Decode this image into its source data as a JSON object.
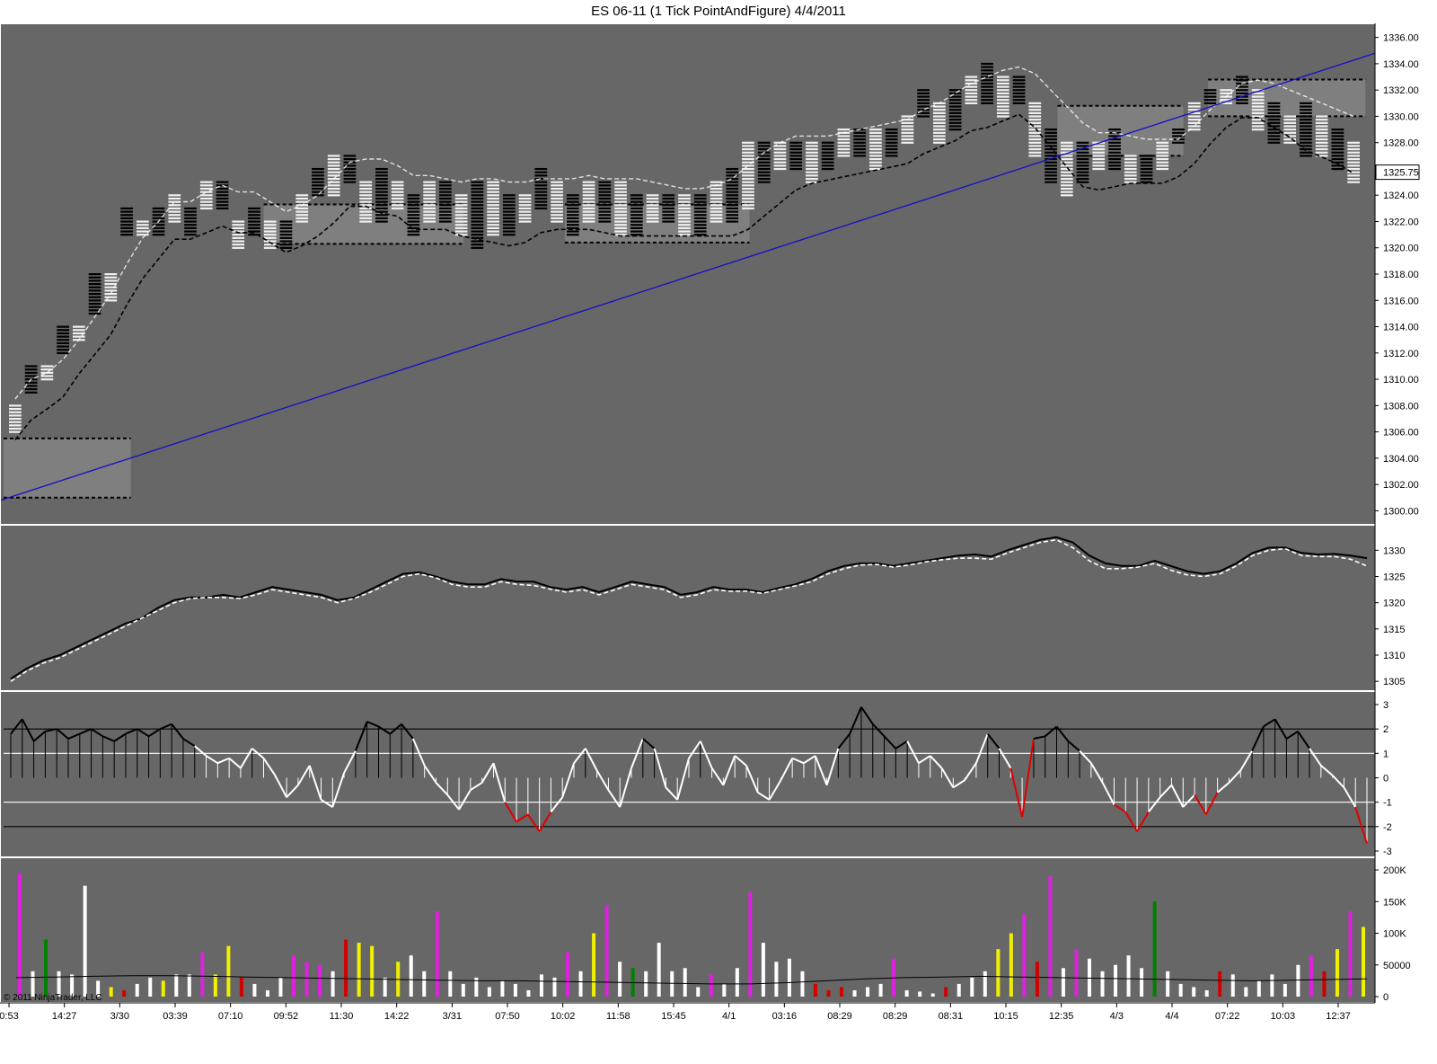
{
  "title": "ES 06-11 (1 Tick PointAndFigure)  4/4/2011",
  "copyright": "© 2011 NinjaTrader, LLC",
  "colors": {
    "panel_bg": "#676767",
    "axis_bg": "#ffffff",
    "trendline": "#1010c8",
    "up_box": "#f0f0f0",
    "down_box": "#000000",
    "oscillator_negative": "#e00000",
    "volume_magenta": "#e020e0",
    "volume_yellow": "#f0f000",
    "volume_red": "#d00000",
    "volume_green": "#008000",
    "volume_white": "#ffffff"
  },
  "chart_data": [
    {
      "type": "point-and-figure",
      "panel": "price",
      "y_ticks": [
        "1336.00",
        "1334.00",
        "1332.00",
        "1330.00",
        "1328.00",
        "1326.00",
        "1324.00",
        "1322.00",
        "1320.00",
        "1318.00",
        "1316.00",
        "1314.00",
        "1312.00",
        "1310.00",
        "1308.00",
        "1306.00",
        "1304.00",
        "1302.00",
        "1300.00"
      ],
      "ylim": [
        1299,
        1337
      ],
      "last_price_label": "1325.75",
      "column_lows": [
        1306,
        1309,
        1310,
        1312,
        1313,
        1315,
        1316,
        1321,
        1321,
        1321,
        1322,
        1321,
        1323,
        1323,
        1320,
        1321,
        1320,
        1320,
        1322,
        1324,
        1324,
        1325,
        1322,
        1322,
        1323,
        1321,
        1322,
        1322,
        1321,
        1320,
        1321,
        1321,
        1322,
        1323,
        1322,
        1321,
        1322,
        1322,
        1321,
        1321,
        1322,
        1322,
        1321,
        1321,
        1322,
        1322,
        1323,
        1325,
        1326,
        1326,
        1325,
        1326,
        1327,
        1327,
        1326,
        1327,
        1328,
        1330,
        1328,
        1329,
        1331,
        1331,
        1330,
        1331,
        1327,
        1325,
        1324,
        1325,
        1326,
        1326,
        1325,
        1325,
        1326,
        1328,
        1329,
        1331,
        1331,
        1331,
        1329,
        1328,
        1328,
        1327,
        1327,
        1326,
        1325
      ],
      "column_highs": [
        1308,
        1311,
        1311,
        1314,
        1314,
        1318,
        1318,
        1323,
        1322,
        1323,
        1324,
        1323,
        1325,
        1325,
        1322,
        1323,
        1322,
        1322,
        1324,
        1326,
        1327,
        1327,
        1325,
        1326,
        1325,
        1324,
        1325,
        1325,
        1324,
        1325,
        1325,
        1324,
        1324,
        1326,
        1325,
        1324,
        1325,
        1325,
        1325,
        1324,
        1324,
        1324,
        1324,
        1324,
        1325,
        1326,
        1328,
        1328,
        1328,
        1328,
        1328,
        1328,
        1329,
        1329,
        1329,
        1329,
        1330,
        1332,
        1331,
        1332,
        1333,
        1334,
        1333,
        1333,
        1331,
        1329,
        1328,
        1328,
        1328,
        1329,
        1327,
        1327,
        1328,
        1329,
        1331,
        1332,
        1332,
        1333,
        1332,
        1331,
        1330,
        1331,
        1330,
        1329,
        1328
      ],
      "trendline": {
        "from": [
          0,
          1300.8
        ],
        "to": [
          1,
          1334.8
        ]
      },
      "rectangles": [
        {
          "x0": 0.0,
          "x1": 0.093,
          "y_top": 1305.5,
          "y_bottom": 1301.0
        },
        {
          "x0": 0.19,
          "x1": 0.336,
          "y_top": 1323.3,
          "y_bottom": 1320.3
        },
        {
          "x0": 0.41,
          "x1": 0.545,
          "y_top": 1323.3,
          "y_bottom": 1320.4
        },
        {
          "x0": 0.77,
          "x1": 0.862,
          "y_top": 1330.8,
          "y_bottom": 1327.0
        },
        {
          "x0": 0.88,
          "x1": 0.995,
          "y_top": 1332.8,
          "y_bottom": 1330.0
        }
      ]
    },
    {
      "type": "line",
      "panel": "moving averages",
      "y_ticks": [
        "1330",
        "1325",
        "1320",
        "1315",
        "1310",
        "1305"
      ],
      "ylim": [
        1304,
        1334
      ],
      "series": [
        {
          "style": "solid-black",
          "values": [
            1305.5,
            1307.5,
            1309,
            1310,
            1311.5,
            1313,
            1314.5,
            1316,
            1317,
            1319,
            1320.5,
            1321,
            1321,
            1321.5,
            1321,
            1322,
            1323,
            1322.5,
            1322,
            1321.5,
            1320.5,
            1321,
            1322.5,
            1324,
            1325.5,
            1325.8,
            1325,
            1324,
            1323.5,
            1323.5,
            1324.5,
            1324,
            1324,
            1323,
            1322.5,
            1323,
            1322,
            1323,
            1324,
            1323.5,
            1323,
            1321.5,
            1322,
            1323,
            1322.5,
            1322.5,
            1322,
            1322.8,
            1323.5,
            1324.5,
            1326,
            1327,
            1327.5,
            1327.5,
            1327,
            1327.5,
            1328,
            1328.5,
            1329,
            1329.2,
            1328.8,
            1330,
            1331,
            1332,
            1332.5,
            1331.5,
            1329,
            1327.5,
            1327,
            1327,
            1328,
            1327,
            1326,
            1325.5,
            1326,
            1327.5,
            1329.5,
            1330.5,
            1330.5,
            1329.5,
            1329.2,
            1329.3,
            1329,
            1328.5
          ]
        },
        {
          "style": "dashed-white",
          "values": [
            1305,
            1307,
            1308.5,
            1309.5,
            1311,
            1312.5,
            1314,
            1315.5,
            1317,
            1318.5,
            1320,
            1320.8,
            1321,
            1321,
            1320.8,
            1321.5,
            1322.5,
            1322,
            1321.5,
            1321,
            1320,
            1320.8,
            1322,
            1323.5,
            1325,
            1325.5,
            1324.8,
            1323.5,
            1323,
            1323,
            1324,
            1323.5,
            1323.3,
            1322.6,
            1322,
            1322.5,
            1321.5,
            1322.5,
            1323.5,
            1323,
            1322.5,
            1321,
            1321.5,
            1322.5,
            1322.2,
            1322.2,
            1321.8,
            1322.5,
            1323.2,
            1324,
            1325.5,
            1326.5,
            1327.2,
            1327.3,
            1326.8,
            1327.2,
            1327.8,
            1328.2,
            1328.5,
            1328.5,
            1328.3,
            1329.5,
            1330.5,
            1331.5,
            1332,
            1330.5,
            1328,
            1326.5,
            1326.5,
            1326.8,
            1327.5,
            1326.2,
            1325.3,
            1325,
            1325.5,
            1327,
            1329,
            1330,
            1330.3,
            1329,
            1328.8,
            1328.8,
            1328.3,
            1327
          ]
        }
      ]
    },
    {
      "type": "line",
      "panel": "oscillator",
      "y_ticks": [
        "3",
        "2",
        "1",
        "0",
        "-1",
        "-2",
        "-3"
      ],
      "ylim": [
        -3,
        3
      ],
      "levels": [
        2,
        1,
        -1,
        -2
      ],
      "values": [
        1.8,
        2.4,
        1.5,
        1.9,
        2,
        1.6,
        1.8,
        2,
        1.7,
        1.5,
        1.8,
        2,
        1.7,
        2,
        2.2,
        1.6,
        1.3,
        0.9,
        0.6,
        0.8,
        0.4,
        1.2,
        0.8,
        0.1,
        -0.8,
        -0.3,
        0.5,
        -0.9,
        -1.2,
        0.2,
        1.1,
        2.3,
        2.1,
        1.8,
        2.2,
        1.6,
        0.5,
        -0.2,
        -0.7,
        -1.3,
        -0.5,
        -0.2,
        0.6,
        -1,
        -1.8,
        -1.5,
        -2.2,
        -1.4,
        -0.8,
        0.6,
        1.2,
        0.3,
        -0.5,
        -1.2,
        0.4,
        1.6,
        1.2,
        -0.4,
        -0.9,
        0.8,
        1.5,
        0.4,
        -0.3,
        0.9,
        0.5,
        -0.6,
        -0.9,
        -0.1,
        0.8,
        0.6,
        0.9,
        -0.3,
        1.2,
        1.8,
        2.9,
        2.2,
        1.7,
        1.2,
        1.5,
        0.6,
        0.9,
        0.4,
        -0.4,
        -0.1,
        0.6,
        1.8,
        1.2,
        0.4,
        -1.6,
        1.6,
        1.7,
        2.1,
        1.5,
        1.1,
        0.6,
        -0.2,
        -1.1,
        -1.4,
        -2.2,
        -1.4,
        -0.8,
        -0.3,
        -1.2,
        -0.7,
        -1.5,
        -0.6,
        -0.2,
        0.3,
        1.1,
        2.1,
        2.4,
        1.6,
        1.9,
        1.2,
        0.5,
        0.1,
        -0.4,
        -1.2,
        -2.7
      ]
    },
    {
      "type": "bar",
      "panel": "volume",
      "y_ticks": [
        "200K",
        "150K",
        "100K",
        "50000",
        "0"
      ],
      "ylim": [
        0,
        210000
      ],
      "values": [
        195000,
        40000,
        90000,
        40000,
        35000,
        175000,
        25000,
        15000,
        10000,
        20000,
        30000,
        25000,
        35000,
        35000,
        70000,
        35000,
        80000,
        30000,
        20000,
        10000,
        30000,
        65000,
        55000,
        50000,
        40000,
        90000,
        85000,
        80000,
        30000,
        55000,
        65000,
        40000,
        135000,
        40000,
        20000,
        30000,
        15000,
        25000,
        20000,
        10000,
        35000,
        30000,
        70000,
        40000,
        100000,
        145000,
        55000,
        45000,
        40000,
        85000,
        40000,
        45000,
        15000,
        35000,
        20000,
        45000,
        165000,
        85000,
        55000,
        60000,
        40000,
        20000,
        10000,
        15000,
        10000,
        15000,
        20000,
        60000,
        10000,
        8000,
        5000,
        15000,
        20000,
        30000,
        40000,
        75000,
        100000,
        130000,
        55000,
        190000,
        45000,
        75000,
        60000,
        40000,
        50000,
        65000,
        45000,
        150000,
        40000,
        20000,
        15000,
        10000,
        40000,
        35000,
        15000,
        25000,
        35000,
        20000,
        50000,
        65000,
        40000,
        75000,
        135000,
        110000
      ],
      "colors": [
        "m",
        "w",
        "g",
        "w",
        "w",
        "w",
        "w",
        "y",
        "r",
        "w",
        "w",
        "y",
        "w",
        "w",
        "m",
        "y",
        "y",
        "r",
        "w",
        "w",
        "w",
        "m",
        "m",
        "m",
        "w",
        "r",
        "y",
        "y",
        "w",
        "y",
        "w",
        "w",
        "m",
        "w",
        "w",
        "w",
        "w",
        "w",
        "w",
        "w",
        "w",
        "w",
        "m",
        "w",
        "y",
        "m",
        "w",
        "g",
        "w",
        "w",
        "w",
        "w",
        "w",
        "m",
        "w",
        "w",
        "m",
        "w",
        "w",
        "w",
        "w",
        "r",
        "r",
        "r",
        "w",
        "w",
        "w",
        "m",
        "w",
        "w",
        "w",
        "r",
        "w",
        "w",
        "w",
        "y",
        "y",
        "m",
        "r",
        "m",
        "w",
        "m",
        "w",
        "w",
        "w",
        "w",
        "w",
        "g",
        "w",
        "w",
        "w",
        "w",
        "r",
        "w",
        "w",
        "w",
        "w",
        "w",
        "w",
        "m",
        "r",
        "y",
        "m",
        "y"
      ],
      "ma_values": [
        30000,
        31000,
        32000,
        33000,
        33000,
        32000,
        31000,
        30000,
        29000,
        28000,
        27000,
        26000,
        25000,
        25000,
        24000,
        23000,
        22000,
        21000,
        20000,
        20000,
        22000,
        25000,
        28000,
        30000,
        31000,
        32000,
        31000,
        30000,
        29000,
        28000,
        27000,
        26000,
        25000,
        26000,
        27000,
        28000
      ],
      "x_ticks": [
        "0:53",
        "14:27",
        "3/30",
        "03:39",
        "07:10",
        "09:52",
        "11:30",
        "14:22",
        "3/31",
        "07:50",
        "10:02",
        "11:58",
        "15:45",
        "4/1",
        "03:16",
        "08:29",
        "08:29",
        "08:31",
        "10:15",
        "12:35",
        "4/3",
        "4/4",
        "07:22",
        "10:03",
        "12:37"
      ]
    }
  ]
}
